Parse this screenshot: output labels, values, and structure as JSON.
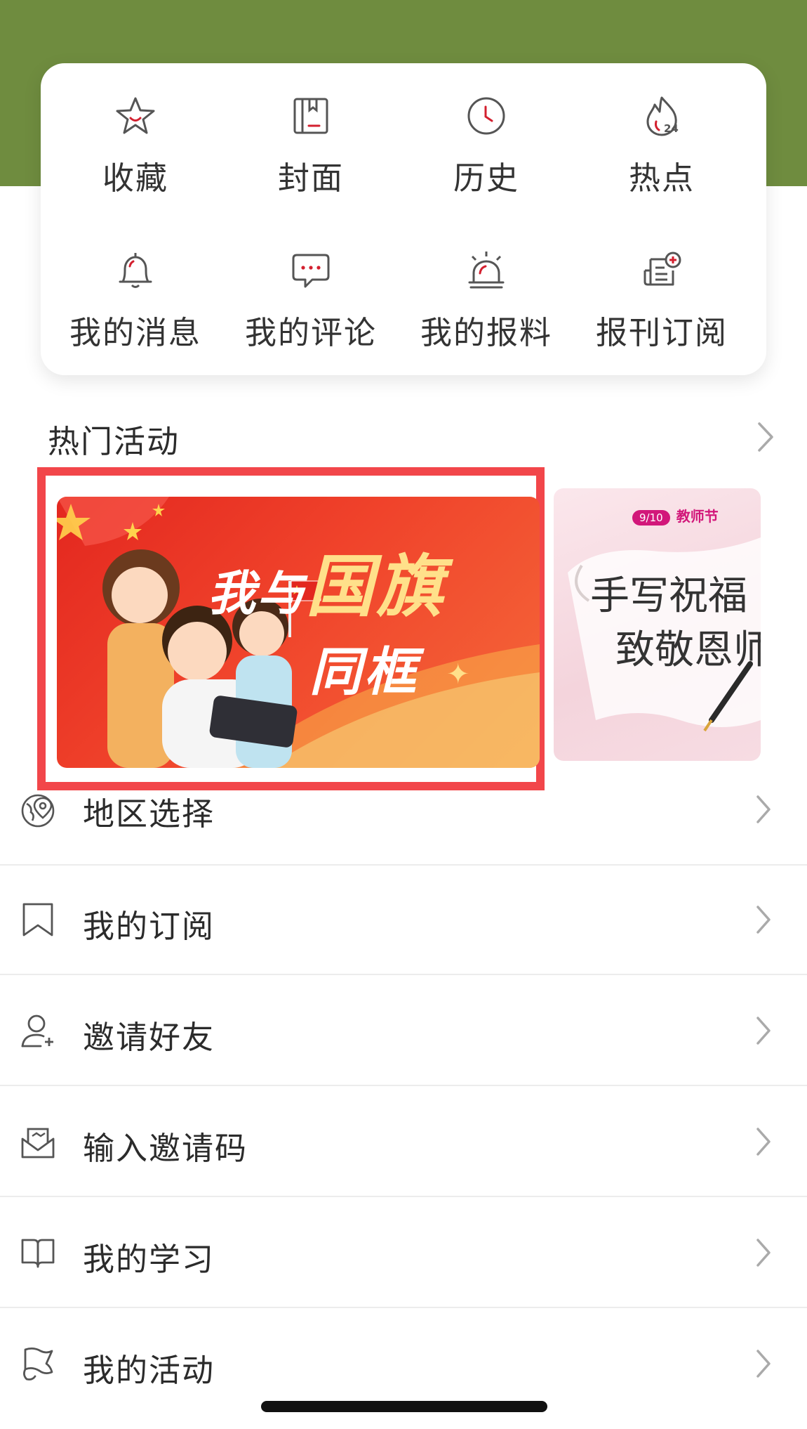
{
  "colors": {
    "accent": "#d3202f",
    "header": "#6f8c3f",
    "banner_border": "#f2464a"
  },
  "grid": [
    {
      "label": "收藏",
      "icon": "star-icon"
    },
    {
      "label": "封面",
      "icon": "cover-icon"
    },
    {
      "label": "历史",
      "icon": "clock-icon"
    },
    {
      "label": "热点",
      "icon": "flame-24-icon",
      "badge": "24"
    },
    {
      "label": "我的消息",
      "icon": "bell-icon"
    },
    {
      "label": "我的评论",
      "icon": "comment-icon"
    },
    {
      "label": "我的报料",
      "icon": "siren-icon"
    },
    {
      "label": "报刊订阅",
      "icon": "subscribe-icon"
    }
  ],
  "hot": {
    "title": "热门活动",
    "banner1": {
      "line1a": "我与",
      "line1b": "国旗",
      "line2": "同框"
    },
    "banner2": {
      "tag_date": "9/10",
      "tag_name": "教师节",
      "line1": "手写祝福",
      "line2": "致敬恩师"
    }
  },
  "list": [
    {
      "label": "地区选择",
      "icon": "globe-location-icon"
    },
    {
      "label": "我的订阅",
      "icon": "bookmark-icon"
    },
    {
      "label": "邀请好友",
      "icon": "add-user-icon"
    },
    {
      "label": "输入邀请码",
      "icon": "invite-code-icon"
    },
    {
      "label": "我的学习",
      "icon": "book-icon"
    },
    {
      "label": "我的活动",
      "icon": "flag-icon"
    }
  ]
}
